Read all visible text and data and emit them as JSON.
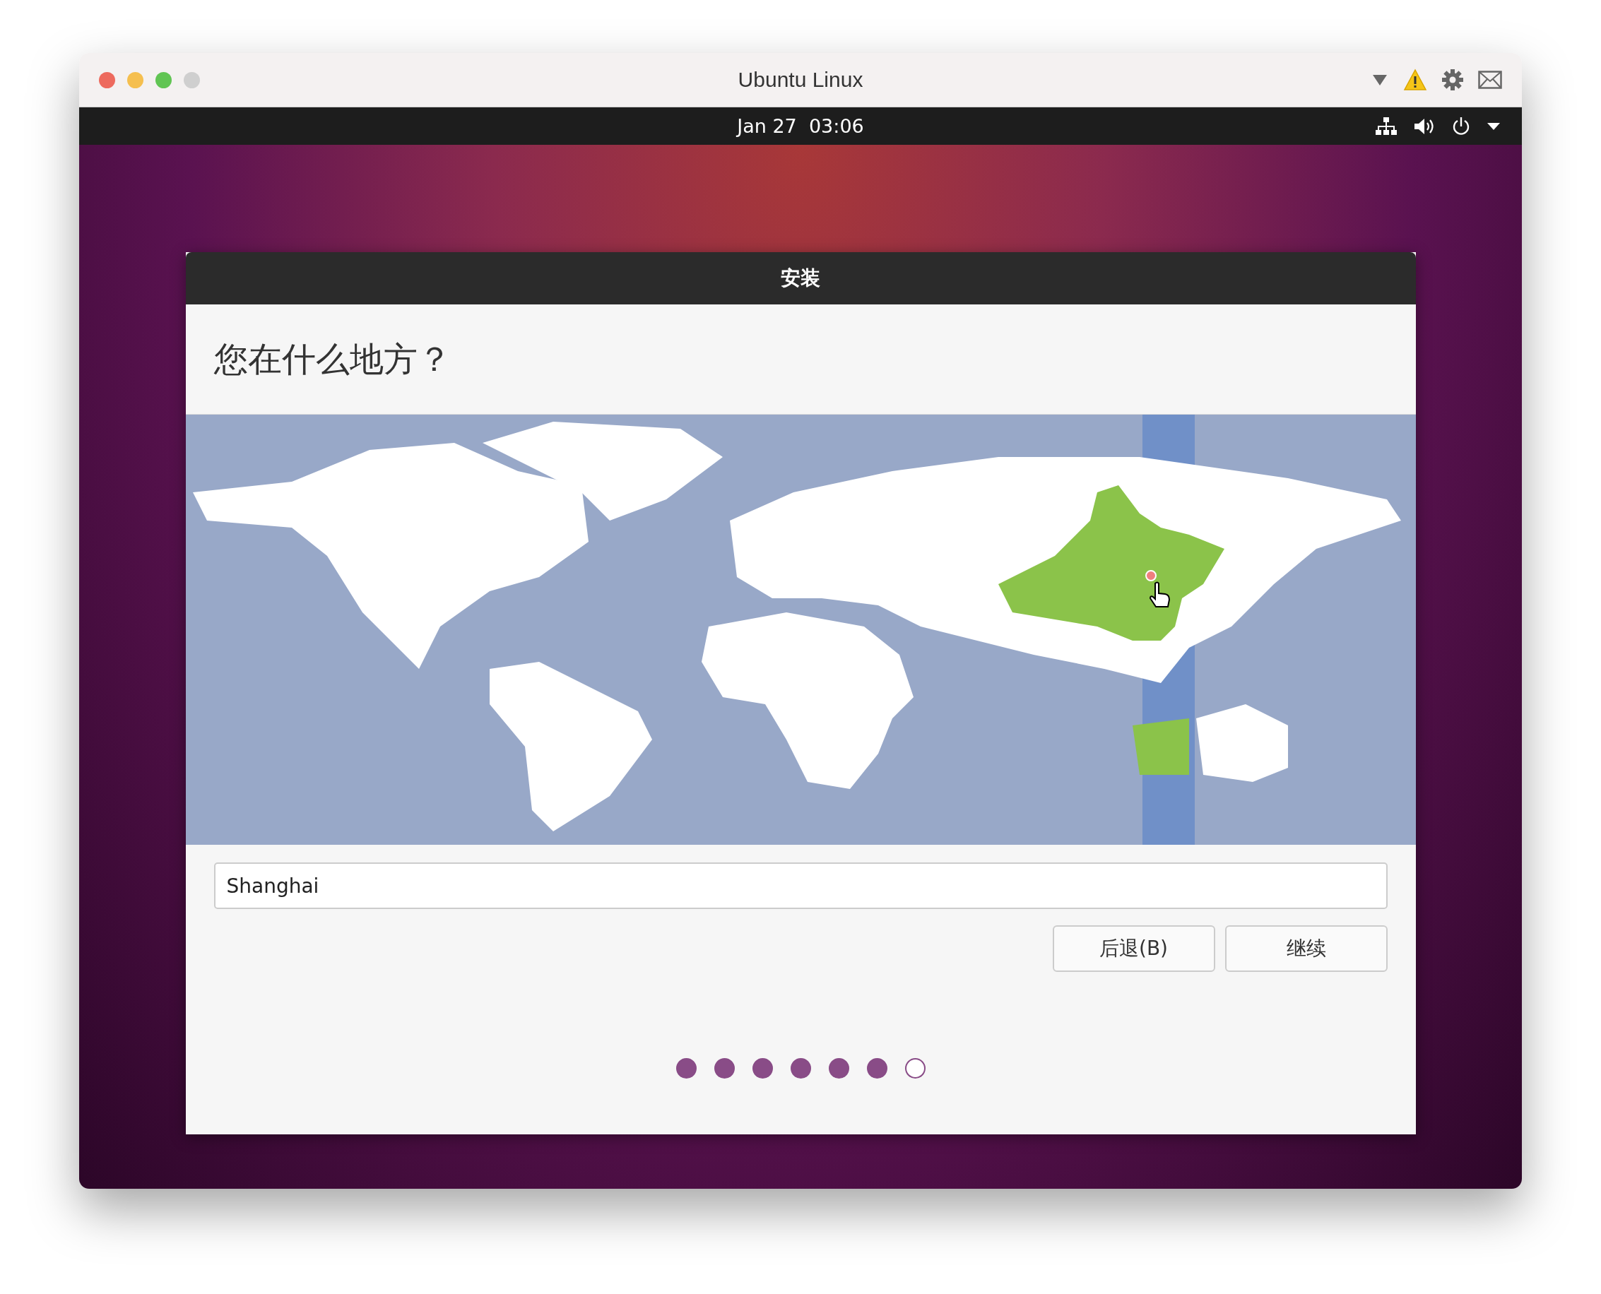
{
  "window": {
    "title": "Ubuntu Linux"
  },
  "top_bar": {
    "clock": "Jan 27  03:06"
  },
  "dialog": {
    "title": "安装",
    "heading": "您在什么地方？",
    "location_field": {
      "value": "Shanghai"
    },
    "buttons": [
      {
        "label": "后退(B)"
      },
      {
        "label": "继续"
      }
    ],
    "steps": [
      {
        "completed": true
      },
      {
        "completed": true
      },
      {
        "completed": true
      },
      {
        "completed": true
      },
      {
        "completed": true
      },
      {
        "completed": true
      },
      {
        "completed": false
      }
    ]
  }
}
